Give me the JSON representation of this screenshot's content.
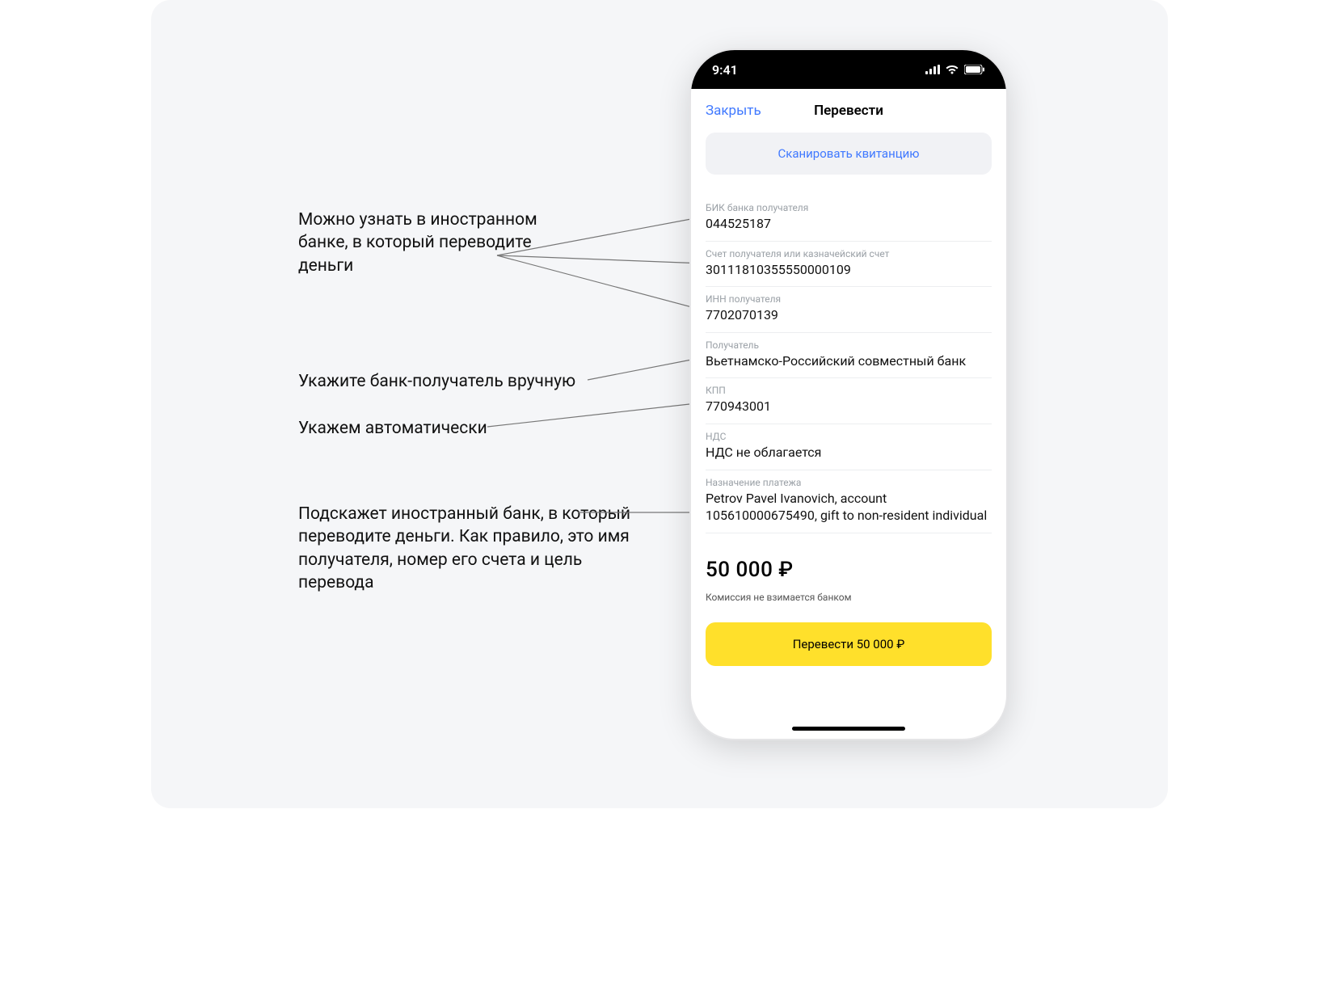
{
  "statusbar": {
    "time": "9:41"
  },
  "nav": {
    "close_label": "Закрыть",
    "title": "Перевести"
  },
  "scan_label": "Сканировать квитанцию",
  "fields": {
    "bik": {
      "label": "БИК банка получателя",
      "value": "044525187"
    },
    "account": {
      "label": "Счет получателя или казначейский счет",
      "value": "30111810355550000109"
    },
    "inn": {
      "label": "ИНН получателя",
      "value": "7702070139"
    },
    "payee": {
      "label": "Получатель",
      "value": "Вьетнамско-Российский совместный банк"
    },
    "kpp": {
      "label": "КПП",
      "value": "770943001"
    },
    "nds": {
      "label": "НДС",
      "value": "НДС не облагается"
    },
    "purpose": {
      "label": "Назначение платежа",
      "value": "Petrov Pavel Ivanovich, account 105610000675490, gift to non-resident individual"
    }
  },
  "amount": "50 000 ₽",
  "fee_note": "Комиссия не взимается банком",
  "transfer_button": "Перевести 50 000 ₽",
  "annotations": {
    "ann1": "Можно узнать в иностранном банке, в который переводите деньги",
    "ann2": "Укажите банк-получатель вручную",
    "ann3": "Укажем автоматически",
    "ann4": "Подскажет иностранный банк, в который переводите деньги. Как правило, это имя получателя, номер его счета и цель перевода"
  }
}
